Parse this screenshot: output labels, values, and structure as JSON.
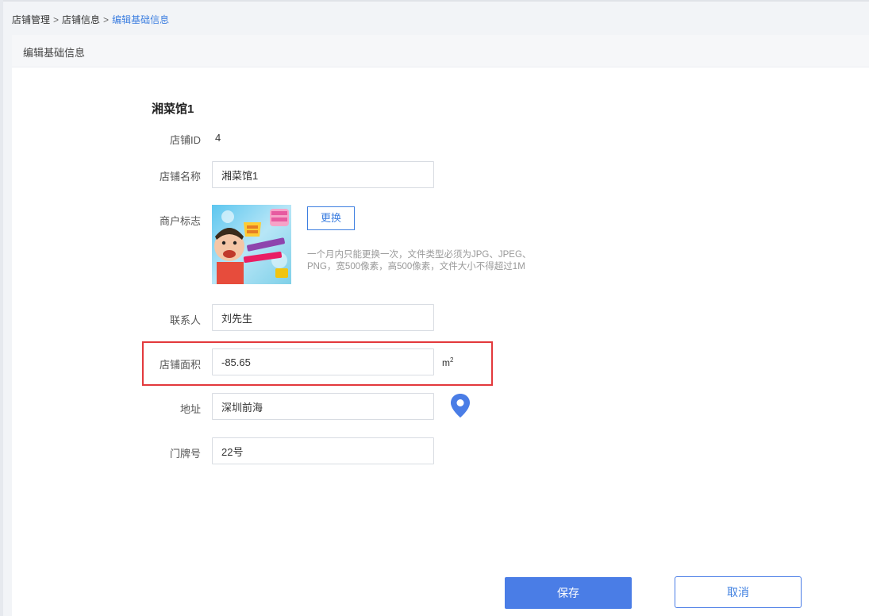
{
  "breadcrumb": {
    "items": [
      "店铺管理",
      "店铺信息",
      "编辑基础信息"
    ],
    "separator": ">"
  },
  "card": {
    "title": "编辑基础信息"
  },
  "store": {
    "name_heading": "湘菜馆1",
    "id_label": "店铺ID",
    "id_value": "4",
    "name_label": "店铺名称",
    "name_value": "湘菜馆1",
    "logo_label": "商户标志",
    "logo_change_label": "更换",
    "logo_hint": "一个月内只能更换一次，文件类型必须为JPG、JPEG、PNG，宽500像素，高500像素，文件大小不得超过1M",
    "contact_label": "联系人",
    "contact_value": "刘先生",
    "area_label": "店铺面积",
    "area_value": "-85.65",
    "area_unit": "m",
    "area_unit_sup": "2",
    "address_label": "地址",
    "address_value": "深圳前海",
    "address_icon": "map-pin-icon",
    "house_no_label": "门牌号",
    "house_no_value": "22号"
  },
  "actions": {
    "save_label": "保存",
    "cancel_label": "取消"
  },
  "colors": {
    "accent": "#4a7de6",
    "highlight_border": "#e3393c",
    "pin": "#4a7de6"
  }
}
